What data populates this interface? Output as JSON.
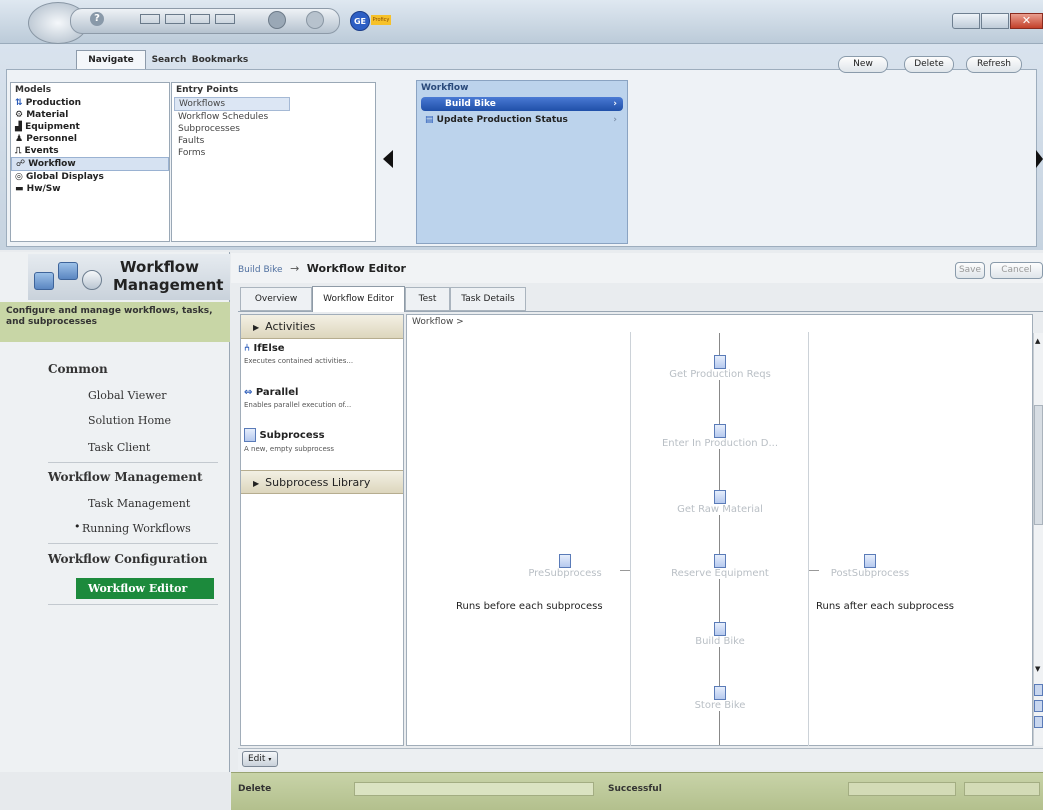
{
  "app": {
    "logo_text": "GE",
    "logo_sub": "Proficy"
  },
  "ribbon": {
    "tabs": [
      "Navigate",
      "Search",
      "Bookmarks"
    ],
    "models_header": "Models",
    "models": [
      "Production",
      "Material",
      "Equipment",
      "Personnel",
      "Events",
      "Workflow",
      "Global Displays",
      "Hw/Sw"
    ],
    "entry_header": "Entry Points",
    "entries": [
      "Workflows",
      "Workflow Schedules",
      "Subprocesses",
      "Faults",
      "Forms"
    ],
    "workflow_header": "Workflow",
    "workflows": [
      "Build Bike",
      "Update Production Status"
    ],
    "buttons": {
      "new": "New",
      "delete": "Delete",
      "refresh": "Refresh"
    }
  },
  "left": {
    "title_line1": "Workflow",
    "title_line2": "Management",
    "subtitle": "Configure and manage workflows, tasks, and subprocesses",
    "sections": [
      {
        "header": "Common",
        "items": [
          "Global Viewer",
          "Solution Home",
          "Task Client"
        ]
      },
      {
        "header": "Workflow Management",
        "items": [
          "Task Management",
          "Running Workflows"
        ]
      },
      {
        "header": "Workflow Configuration",
        "items": [
          "Workflow Editor"
        ]
      }
    ]
  },
  "editor": {
    "breadcrumb_parent": "Build Bike",
    "breadcrumb_arrow": "→",
    "breadcrumb_current": "Workflow Editor",
    "save": "Save",
    "cancel": "Cancel",
    "tabs": [
      "Overview",
      "Workflow Editor",
      "Test",
      "Task Details"
    ],
    "activities_header": "Activities",
    "activities": [
      {
        "name": "IfElse",
        "desc": "Executes contained activities..."
      },
      {
        "name": "Parallel",
        "desc": "Enables parallel execution of..."
      },
      {
        "name": "Subprocess",
        "desc": "A new, empty subprocess"
      }
    ],
    "library_header": "Subprocess Library",
    "canvas_breadcrumb": "Workflow >",
    "pre_label": "PreSubprocess",
    "pre_desc": "Runs before each subprocess",
    "post_label": "PostSubprocess",
    "post_desc": "Runs after each subprocess",
    "steps": [
      "Get Production Reqs",
      "Enter In Production D...",
      "Get Raw Material",
      "Reserve Equipment",
      "Build Bike",
      "Store Bike"
    ],
    "edit_button": "Edit"
  },
  "status": {
    "left": "Delete",
    "right": "Successful"
  },
  "colors": {
    "accent_green": "#1c8a3c",
    "ribbon_blue": "#bcd3ec",
    "selected_blue": "#2a5bb8"
  }
}
